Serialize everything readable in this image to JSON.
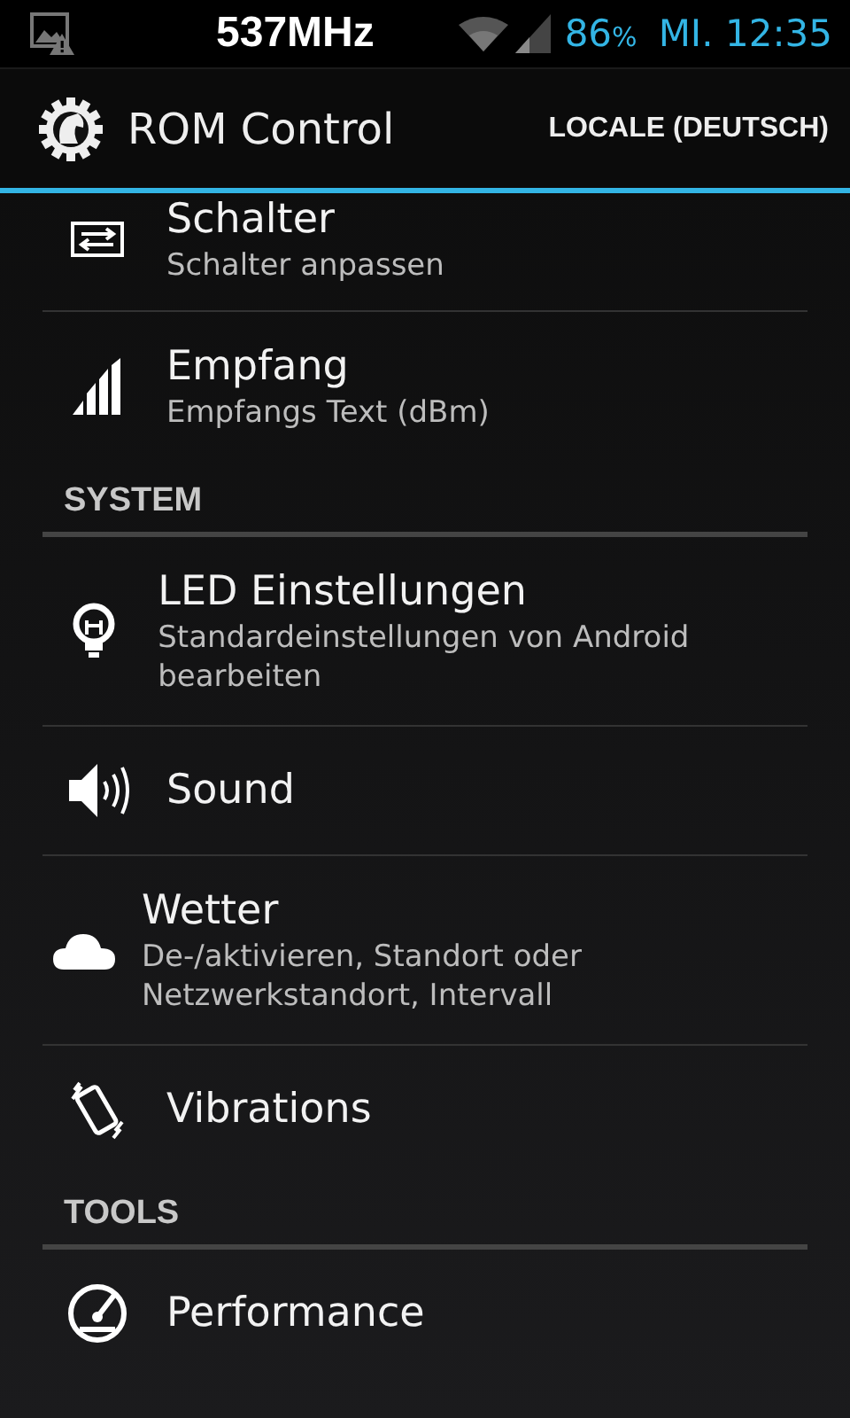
{
  "status_bar": {
    "cpu": "537MHz",
    "battery": "86",
    "battery_unit": "%",
    "clock": "MI. 12:35"
  },
  "action_bar": {
    "title": "ROM Control",
    "action": "LOCALE (DEUTSCH)"
  },
  "list": [
    {
      "kind": "item",
      "title": "Schalter",
      "summary": "Schalter anpassen"
    },
    {
      "kind": "item",
      "title": "Empfang",
      "summary": "Empfangs Text (dBm)"
    },
    {
      "kind": "category",
      "title": "SYSTEM"
    },
    {
      "kind": "item",
      "title": "LED Einstellungen",
      "summary": "Standardeinstellungen von Android bearbeiten"
    },
    {
      "kind": "item",
      "title": "Sound"
    },
    {
      "kind": "item",
      "title": "Wetter",
      "summary": "De-/aktivieren, Standort oder Netzwerkstandort, Intervall"
    },
    {
      "kind": "item",
      "title": "Vibrations"
    },
    {
      "kind": "category",
      "title": "TOOLS"
    },
    {
      "kind": "item",
      "title": "Performance"
    }
  ]
}
